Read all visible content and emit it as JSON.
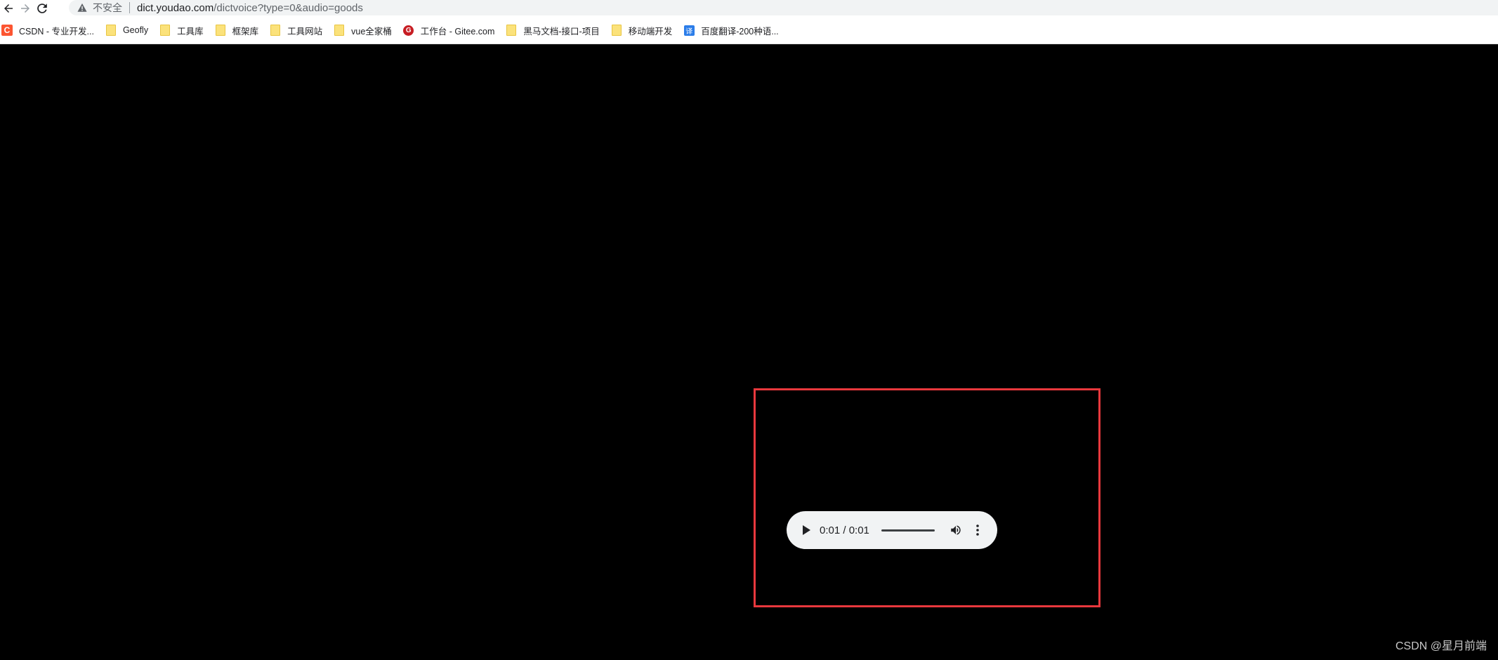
{
  "browser": {
    "nav": {
      "back_icon": "arrow-left-icon",
      "forward_icon": "arrow-right-icon",
      "reload_icon": "reload-icon"
    },
    "omnibox": {
      "security_icon": "warning-triangle-icon",
      "security_label": "不安全",
      "url_host": "dict.youdao.com",
      "url_path": "/dictvoice?type=0&audio=goods"
    }
  },
  "bookmarks": [
    {
      "label": "CSDN - 专业开发...",
      "icon": "csdn-icon"
    },
    {
      "label": "Geofly",
      "icon": "folder-icon"
    },
    {
      "label": "工具库",
      "icon": "folder-icon"
    },
    {
      "label": "框架库",
      "icon": "folder-icon"
    },
    {
      "label": "工具网站",
      "icon": "folder-icon"
    },
    {
      "label": "vue全家桶",
      "icon": "folder-icon"
    },
    {
      "label": "工作台 - Gitee.com",
      "icon": "gitee-icon"
    },
    {
      "label": "黑马文档-接口-项目",
      "icon": "folder-icon"
    },
    {
      "label": "移动端开发",
      "icon": "folder-icon"
    },
    {
      "label": "百度翻译-200种语...",
      "icon": "fanyi-icon"
    }
  ],
  "audio_player": {
    "play_icon": "play-icon",
    "time": "0:01 / 0:01",
    "progress": 1.0,
    "volume_icon": "volume-icon",
    "more_icon": "more-vertical-icon"
  },
  "colors": {
    "highlight_border": "#e8383d",
    "page_background": "#000000",
    "player_background": "#f1f3f4"
  },
  "watermark": "CSDN @星月前端"
}
